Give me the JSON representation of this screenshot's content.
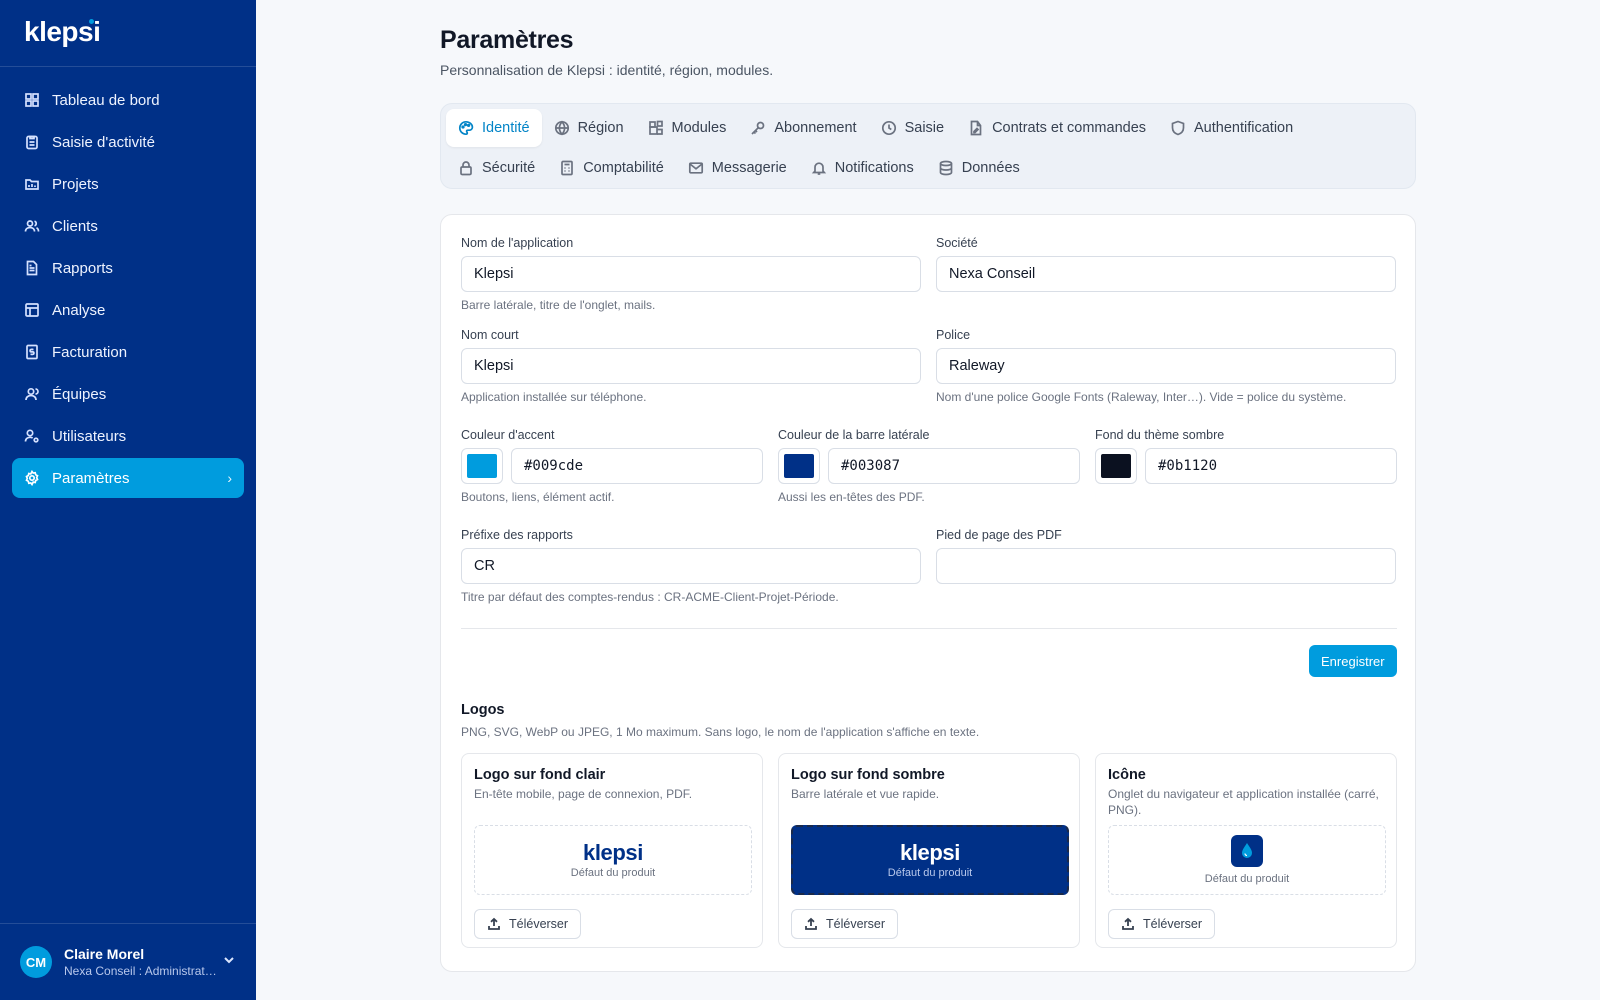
{
  "app": {
    "brand": "klepsi",
    "accent": "#009cde",
    "sidebar_color": "#003087"
  },
  "sidebar": {
    "items": [
      {
        "label": "Tableau de bord",
        "icon": "dashboard-icon"
      },
      {
        "label": "Saisie d'activité",
        "icon": "clipboard-icon"
      },
      {
        "label": "Projets",
        "icon": "folder-icon"
      },
      {
        "label": "Clients",
        "icon": "users-icon"
      },
      {
        "label": "Rapports",
        "icon": "report-icon"
      },
      {
        "label": "Analyse",
        "icon": "table-icon"
      },
      {
        "label": "Facturation",
        "icon": "invoice-icon"
      },
      {
        "label": "Équipes",
        "icon": "team-icon"
      },
      {
        "label": "Utilisateurs",
        "icon": "user-cog-icon"
      },
      {
        "label": "Paramètres",
        "icon": "gear-icon",
        "active": true
      }
    ],
    "user": {
      "initials": "CM",
      "name": "Claire Morel",
      "role": "Nexa Conseil : Administrateur"
    }
  },
  "header": {
    "title": "Paramètres",
    "subtitle": "Personnalisation de Klepsi : identité, région, modules."
  },
  "tabs": {
    "row1": [
      "Identité",
      "Région",
      "Modules",
      "Abonnement",
      "Saisie",
      "Contrats et commandes",
      "Authentification"
    ],
    "row2": [
      "Sécurité",
      "Comptabilité",
      "Messagerie",
      "Notifications",
      "Données"
    ],
    "active": "Identité"
  },
  "form": {
    "app_name": {
      "label": "Nom de l'application",
      "value": "Klepsi",
      "hint": "Barre latérale, titre de l'onglet, mails."
    },
    "company": {
      "label": "Société",
      "value": "Nexa Conseil"
    },
    "short_name": {
      "label": "Nom court",
      "value": "Klepsi",
      "hint": "Application installée sur téléphone."
    },
    "font": {
      "label": "Police",
      "value": "Raleway",
      "hint": "Nom d'une police Google Fonts (Raleway, Inter…). Vide = police du système."
    },
    "accent_color": {
      "label": "Couleur d'accent",
      "value": "#009cde",
      "hint": "Boutons, liens, élément actif."
    },
    "sidebar_color": {
      "label": "Couleur de la barre latérale",
      "value": "#003087",
      "hint": "Aussi les en-têtes des PDF."
    },
    "dark_bg": {
      "label": "Fond du thème sombre",
      "value": "#0b1120"
    },
    "report_prefix": {
      "label": "Préfixe des rapports",
      "value": "CR",
      "hint": "Titre par défaut des comptes-rendus : CR-ACME-Client-Projet-Période."
    },
    "pdf_footer": {
      "label": "Pied de page des PDF",
      "value": ""
    },
    "save_label": "Enregistrer"
  },
  "logos": {
    "title": "Logos",
    "subtitle": "PNG, SVG, WebP ou JPEG, 1 Mo maximum. Sans logo, le nom de l'application s'affiche en texte.",
    "cards": [
      {
        "title": "Logo sur fond clair",
        "subtitle": "En-tête mobile, page de connexion, PDF.",
        "preview_text": "klepsi",
        "caption": "Défaut du produit",
        "upload": "Téléverser"
      },
      {
        "title": "Logo sur fond sombre",
        "subtitle": "Barre latérale et vue rapide.",
        "preview_text": "klepsi",
        "caption": "Défaut du produit",
        "upload": "Téléverser"
      },
      {
        "title": "Icône",
        "subtitle": "Onglet du navigateur et application installée (carré, PNG).",
        "caption": "Défaut du produit",
        "upload": "Téléverser"
      }
    ]
  }
}
